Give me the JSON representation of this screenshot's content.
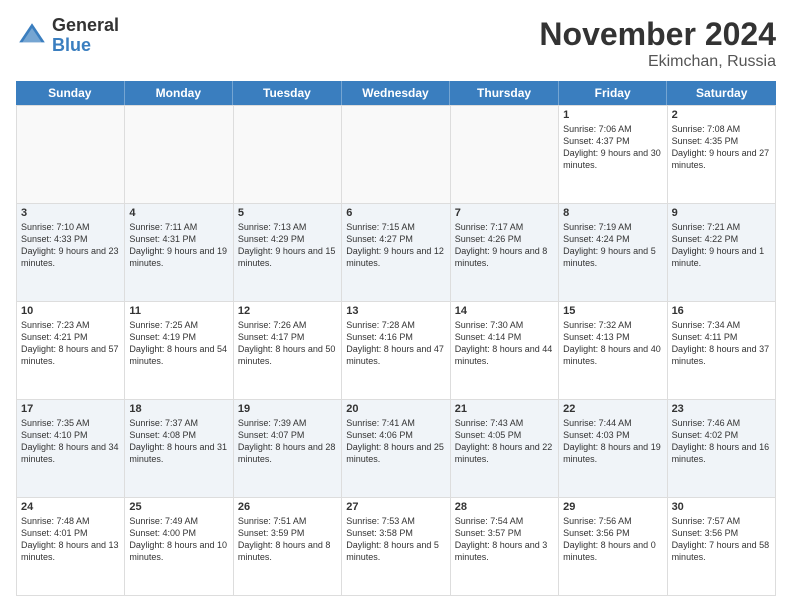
{
  "logo": {
    "general": "General",
    "blue": "Blue"
  },
  "header": {
    "month": "November 2024",
    "location": "Ekimchan, Russia"
  },
  "weekdays": [
    "Sunday",
    "Monday",
    "Tuesday",
    "Wednesday",
    "Thursday",
    "Friday",
    "Saturday"
  ],
  "weeks": [
    [
      {
        "day": "",
        "empty": true
      },
      {
        "day": "",
        "empty": true
      },
      {
        "day": "",
        "empty": true
      },
      {
        "day": "",
        "empty": true
      },
      {
        "day": "",
        "empty": true
      },
      {
        "day": "1",
        "sunrise": "Sunrise: 7:06 AM",
        "sunset": "Sunset: 4:37 PM",
        "daylight": "Daylight: 9 hours and 30 minutes."
      },
      {
        "day": "2",
        "sunrise": "Sunrise: 7:08 AM",
        "sunset": "Sunset: 4:35 PM",
        "daylight": "Daylight: 9 hours and 27 minutes."
      }
    ],
    [
      {
        "day": "3",
        "sunrise": "Sunrise: 7:10 AM",
        "sunset": "Sunset: 4:33 PM",
        "daylight": "Daylight: 9 hours and 23 minutes."
      },
      {
        "day": "4",
        "sunrise": "Sunrise: 7:11 AM",
        "sunset": "Sunset: 4:31 PM",
        "daylight": "Daylight: 9 hours and 19 minutes."
      },
      {
        "day": "5",
        "sunrise": "Sunrise: 7:13 AM",
        "sunset": "Sunset: 4:29 PM",
        "daylight": "Daylight: 9 hours and 15 minutes."
      },
      {
        "day": "6",
        "sunrise": "Sunrise: 7:15 AM",
        "sunset": "Sunset: 4:27 PM",
        "daylight": "Daylight: 9 hours and 12 minutes."
      },
      {
        "day": "7",
        "sunrise": "Sunrise: 7:17 AM",
        "sunset": "Sunset: 4:26 PM",
        "daylight": "Daylight: 9 hours and 8 minutes."
      },
      {
        "day": "8",
        "sunrise": "Sunrise: 7:19 AM",
        "sunset": "Sunset: 4:24 PM",
        "daylight": "Daylight: 9 hours and 5 minutes."
      },
      {
        "day": "9",
        "sunrise": "Sunrise: 7:21 AM",
        "sunset": "Sunset: 4:22 PM",
        "daylight": "Daylight: 9 hours and 1 minute."
      }
    ],
    [
      {
        "day": "10",
        "sunrise": "Sunrise: 7:23 AM",
        "sunset": "Sunset: 4:21 PM",
        "daylight": "Daylight: 8 hours and 57 minutes."
      },
      {
        "day": "11",
        "sunrise": "Sunrise: 7:25 AM",
        "sunset": "Sunset: 4:19 PM",
        "daylight": "Daylight: 8 hours and 54 minutes."
      },
      {
        "day": "12",
        "sunrise": "Sunrise: 7:26 AM",
        "sunset": "Sunset: 4:17 PM",
        "daylight": "Daylight: 8 hours and 50 minutes."
      },
      {
        "day": "13",
        "sunrise": "Sunrise: 7:28 AM",
        "sunset": "Sunset: 4:16 PM",
        "daylight": "Daylight: 8 hours and 47 minutes."
      },
      {
        "day": "14",
        "sunrise": "Sunrise: 7:30 AM",
        "sunset": "Sunset: 4:14 PM",
        "daylight": "Daylight: 8 hours and 44 minutes."
      },
      {
        "day": "15",
        "sunrise": "Sunrise: 7:32 AM",
        "sunset": "Sunset: 4:13 PM",
        "daylight": "Daylight: 8 hours and 40 minutes."
      },
      {
        "day": "16",
        "sunrise": "Sunrise: 7:34 AM",
        "sunset": "Sunset: 4:11 PM",
        "daylight": "Daylight: 8 hours and 37 minutes."
      }
    ],
    [
      {
        "day": "17",
        "sunrise": "Sunrise: 7:35 AM",
        "sunset": "Sunset: 4:10 PM",
        "daylight": "Daylight: 8 hours and 34 minutes."
      },
      {
        "day": "18",
        "sunrise": "Sunrise: 7:37 AM",
        "sunset": "Sunset: 4:08 PM",
        "daylight": "Daylight: 8 hours and 31 minutes."
      },
      {
        "day": "19",
        "sunrise": "Sunrise: 7:39 AM",
        "sunset": "Sunset: 4:07 PM",
        "daylight": "Daylight: 8 hours and 28 minutes."
      },
      {
        "day": "20",
        "sunrise": "Sunrise: 7:41 AM",
        "sunset": "Sunset: 4:06 PM",
        "daylight": "Daylight: 8 hours and 25 minutes."
      },
      {
        "day": "21",
        "sunrise": "Sunrise: 7:43 AM",
        "sunset": "Sunset: 4:05 PM",
        "daylight": "Daylight: 8 hours and 22 minutes."
      },
      {
        "day": "22",
        "sunrise": "Sunrise: 7:44 AM",
        "sunset": "Sunset: 4:03 PM",
        "daylight": "Daylight: 8 hours and 19 minutes."
      },
      {
        "day": "23",
        "sunrise": "Sunrise: 7:46 AM",
        "sunset": "Sunset: 4:02 PM",
        "daylight": "Daylight: 8 hours and 16 minutes."
      }
    ],
    [
      {
        "day": "24",
        "sunrise": "Sunrise: 7:48 AM",
        "sunset": "Sunset: 4:01 PM",
        "daylight": "Daylight: 8 hours and 13 minutes."
      },
      {
        "day": "25",
        "sunrise": "Sunrise: 7:49 AM",
        "sunset": "Sunset: 4:00 PM",
        "daylight": "Daylight: 8 hours and 10 minutes."
      },
      {
        "day": "26",
        "sunrise": "Sunrise: 7:51 AM",
        "sunset": "Sunset: 3:59 PM",
        "daylight": "Daylight: 8 hours and 8 minutes."
      },
      {
        "day": "27",
        "sunrise": "Sunrise: 7:53 AM",
        "sunset": "Sunset: 3:58 PM",
        "daylight": "Daylight: 8 hours and 5 minutes."
      },
      {
        "day": "28",
        "sunrise": "Sunrise: 7:54 AM",
        "sunset": "Sunset: 3:57 PM",
        "daylight": "Daylight: 8 hours and 3 minutes."
      },
      {
        "day": "29",
        "sunrise": "Sunrise: 7:56 AM",
        "sunset": "Sunset: 3:56 PM",
        "daylight": "Daylight: 8 hours and 0 minutes."
      },
      {
        "day": "30",
        "sunrise": "Sunrise: 7:57 AM",
        "sunset": "Sunset: 3:56 PM",
        "daylight": "Daylight: 7 hours and 58 minutes."
      }
    ]
  ]
}
